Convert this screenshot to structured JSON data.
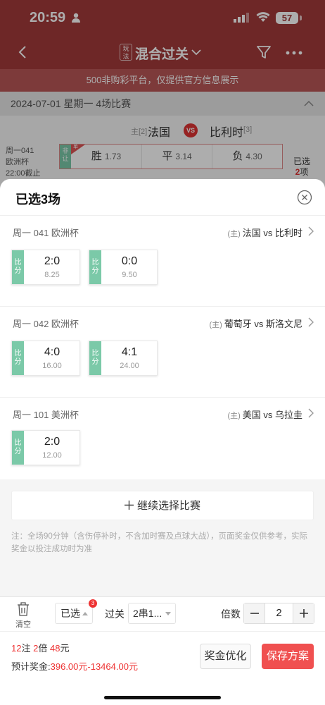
{
  "status_bar": {
    "time": "20:59",
    "battery": "57"
  },
  "nav": {
    "play_tag_1": "玩",
    "play_tag_2": "法",
    "title": "混合过关"
  },
  "notice": "500非购彩平台，仅提供官方信息展示",
  "date_bar": "2024-07-01 星期一   4场比赛",
  "bg_match": {
    "home_tag": "主[2]",
    "home": "法国",
    "vs": "VS",
    "away": "比利时",
    "away_rank": "[3]",
    "info": [
      "周一041",
      "欧洲杯",
      "22:00截止"
    ],
    "strip_1": "非",
    "strip_2": "让",
    "corner": "单",
    "odds": [
      {
        "label": "胜",
        "value": "1.73"
      },
      {
        "label": "平",
        "value": "3.14"
      },
      {
        "label": "负",
        "value": "4.30"
      }
    ],
    "selected_1": "已选",
    "selected_2_count": "2",
    "selected_2_unit": "项"
  },
  "sheet": {
    "title": "已选3场",
    "groups": [
      {
        "left": "周一 041 欧洲杯",
        "home_tag": "(主)",
        "teams": "法国 vs 比利时",
        "bets": [
          {
            "tag_1": "比",
            "tag_2": "分",
            "score": "2:0",
            "odds": "8.25"
          },
          {
            "tag_1": "比",
            "tag_2": "分",
            "score": "0:0",
            "odds": "9.50"
          }
        ]
      },
      {
        "left": "周一 042 欧洲杯",
        "home_tag": "(主)",
        "teams": "葡萄牙 vs 斯洛文尼",
        "bets": [
          {
            "tag_1": "比",
            "tag_2": "分",
            "score": "4:0",
            "odds": "16.00"
          },
          {
            "tag_1": "比",
            "tag_2": "分",
            "score": "4:1",
            "odds": "24.00"
          }
        ]
      },
      {
        "left": "周一 101 美洲杯",
        "home_tag": "(主)",
        "teams": "美国 vs 乌拉圭",
        "bets": [
          {
            "tag_1": "比",
            "tag_2": "分",
            "score": "2:0",
            "odds": "12.00"
          }
        ]
      }
    ],
    "continue_label": "继续选择比赛",
    "note": "注：全场90分钟（含伤停补时，不含加时赛及点球大战），页面奖金仅供参考，实际奖金以投注成功时为准"
  },
  "bottom": {
    "clear_label": "清空",
    "selected_label": "已选",
    "selected_badge": "3",
    "pass_label": "过关",
    "pass_value": "2串1...",
    "multiplier_label": "倍数",
    "multiplier_value": "2",
    "bets_count": "12",
    "bets_unit": "注",
    "multiple_count": "2",
    "multiple_unit": "倍",
    "amount": "48",
    "amount_unit": "元",
    "prize_label": "预计奖金:",
    "prize_range": "396.00元-13464.00元",
    "optimize_label": "奖金优化",
    "save_label": "保存方案"
  }
}
